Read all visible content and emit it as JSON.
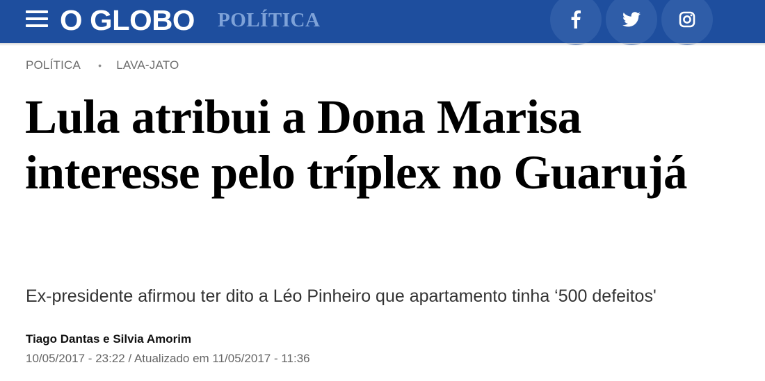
{
  "header": {
    "logo_text": "O GLOBO",
    "section": "POLÍTICA",
    "social": [
      {
        "name": "facebook",
        "icon": "facebook-icon"
      },
      {
        "name": "twitter",
        "icon": "twitter-icon"
      },
      {
        "name": "instagram",
        "icon": "instagram-icon"
      }
    ],
    "colors": {
      "bar": "#1e4e9e",
      "section_text": "#7ea2d8",
      "social_circle": "#2f5da8"
    }
  },
  "breadcrumb": {
    "items": [
      "POLÍTICA",
      "LAVA-JATO"
    ],
    "separator": "•"
  },
  "article": {
    "headline": "Lula atribui a Dona Marisa interesse pelo tríplex no Guarujá",
    "subtitle": "Ex-presidente afirmou ter dito a Léo Pinheiro que apartamento tinha ‘500 defeitos'",
    "authors": "Tiago Dantas e Silvia Amorim",
    "dateline": "10/05/2017 - 23:22 / Atualizado em 11/05/2017 - 11:36"
  }
}
